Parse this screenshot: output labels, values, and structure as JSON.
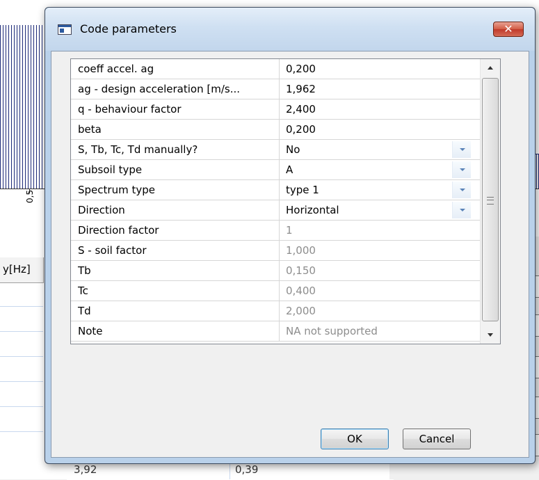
{
  "background": {
    "chart_tick_label": "0,5",
    "table_header_label": "y[Hz]",
    "bottom_row": [
      "3,92",
      "0,39"
    ]
  },
  "dialog": {
    "title": "Code parameters",
    "close_glyph": "✕",
    "rows": [
      {
        "name": "coeff accel. ag",
        "value": "0,200",
        "disabled": false,
        "dropdown": false
      },
      {
        "name": "ag - design acceleration [m/s...",
        "value": "1,962",
        "disabled": false,
        "dropdown": false
      },
      {
        "name": "q - behaviour factor",
        "value": "2,400",
        "disabled": false,
        "dropdown": false
      },
      {
        "name": "beta",
        "value": "0,200",
        "disabled": false,
        "dropdown": false
      },
      {
        "name": "S, Tb, Tc, Td manually?",
        "value": "No",
        "disabled": false,
        "dropdown": true
      },
      {
        "name": "Subsoil type",
        "value": "A",
        "disabled": false,
        "dropdown": true
      },
      {
        "name": "Spectrum type",
        "value": "type 1",
        "disabled": false,
        "dropdown": true
      },
      {
        "name": "Direction",
        "value": "Horizontal",
        "disabled": false,
        "dropdown": true
      },
      {
        "name": "Direction factor",
        "value": "1",
        "disabled": true,
        "dropdown": false
      },
      {
        "name": "S - soil factor",
        "value": "1,000",
        "disabled": true,
        "dropdown": false
      },
      {
        "name": "Tb",
        "value": "0,150",
        "disabled": true,
        "dropdown": false
      },
      {
        "name": "Tc",
        "value": "0,400",
        "disabled": true,
        "dropdown": false
      },
      {
        "name": "Td",
        "value": "2,000",
        "disabled": true,
        "dropdown": false
      },
      {
        "name": "Note",
        "value": "NA not supported",
        "disabled": true,
        "dropdown": false
      }
    ],
    "ok_label": "OK",
    "cancel_label": "Cancel"
  },
  "colors": {
    "chart_bars": "#1c2a78",
    "dialog_frame": "#b9d1ea",
    "close_button": "#c0392b",
    "disabled_text": "#8d8d8d"
  }
}
